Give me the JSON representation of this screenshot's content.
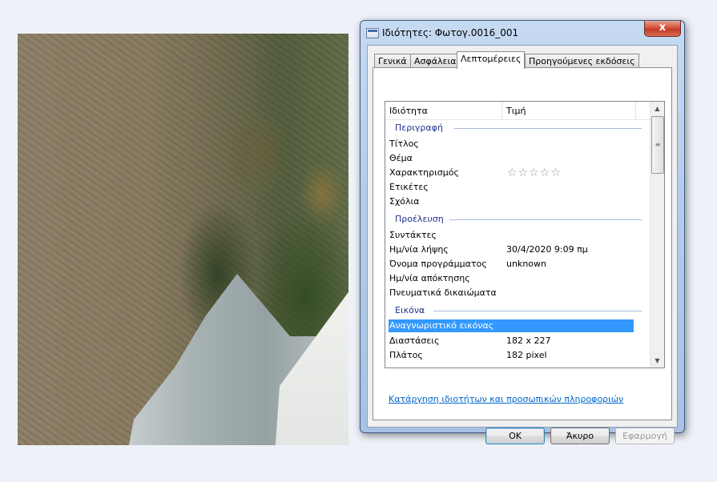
{
  "dialog": {
    "title": "Ιδιότητες: Φωτογ.0016_001",
    "close_label": "x",
    "tabs": [
      {
        "label": "Γενικά",
        "active": false
      },
      {
        "label": "Ασφάλεια",
        "active": false
      },
      {
        "label": "Λεπτομέρειες",
        "active": true
      },
      {
        "label": "Προηγούμενες εκδόσεις",
        "active": false
      }
    ],
    "columns": {
      "property": "Ιδιότητα",
      "value": "Τιμή"
    },
    "groups": {
      "description": "Περιγραφή",
      "origin": "Προέλευση",
      "image": "Εικόνα"
    },
    "description_rows": [
      {
        "key": "Τίτλος",
        "value": ""
      },
      {
        "key": "Θέμα",
        "value": ""
      },
      {
        "key": "Χαρακτηρισμός",
        "value": ""
      },
      {
        "key": "Ετικέτες",
        "value": ""
      },
      {
        "key": "Σχόλια",
        "value": ""
      }
    ],
    "rating_stars": "☆☆☆☆☆",
    "rating_value": 0,
    "origin_rows": [
      {
        "key": "Συντάκτες",
        "value": ""
      },
      {
        "key": "Ημ/νία λήψης",
        "value": "30/4/2020 9:09 πμ"
      },
      {
        "key": "Όνομα προγράμματος",
        "value": "unknown"
      },
      {
        "key": "Ημ/νία απόκτησης",
        "value": ""
      },
      {
        "key": "Πνευματικά δικαιώματα",
        "value": ""
      }
    ],
    "image_rows": [
      {
        "key": "Αναγνωριστικό εικόνας",
        "value": "",
        "selected": true
      },
      {
        "key": "Διαστάσεις",
        "value": "182 x 227"
      },
      {
        "key": "Πλάτος",
        "value": "182 pixel"
      }
    ],
    "remove_link": "Κατάργηση ιδιοτήτων και προσωπικών πληροφοριών",
    "buttons": {
      "ok": "OK",
      "cancel": "Άκυρο",
      "apply": "Εφαρμογή"
    },
    "accent_selection": "#3399ff",
    "link_color": "#0066cc"
  }
}
